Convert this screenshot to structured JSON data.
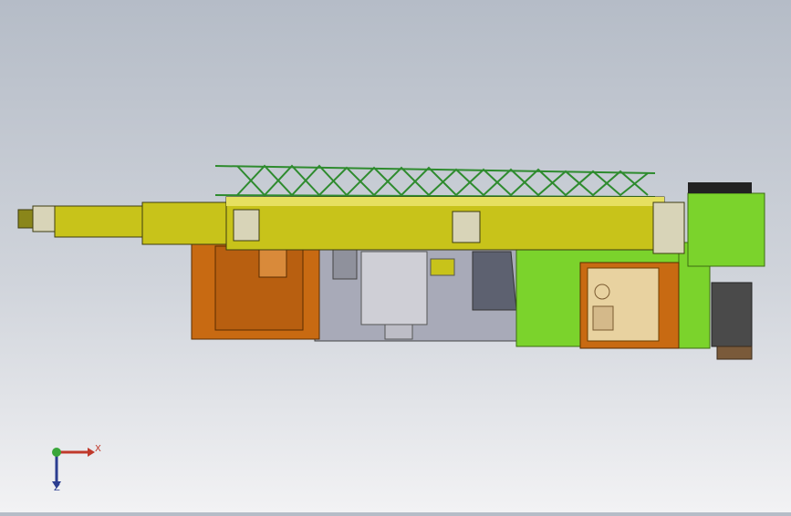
{
  "window": {
    "title": ""
  },
  "viewport": {
    "model_name": "",
    "colors": {
      "boom": "#c8c31a",
      "boom_dark": "#8a861a",
      "lattice": "#3aa63a",
      "carrier_green": "#7bd32c",
      "cab_orange": "#c86a12",
      "frame_gray": "#a8aab8"
    }
  },
  "triad": {
    "x_label": "X",
    "z_label": "Z",
    "icons": [
      "x-axis-arrow-icon",
      "z-axis-arrow-icon",
      "origin-sphere-icon"
    ]
  }
}
